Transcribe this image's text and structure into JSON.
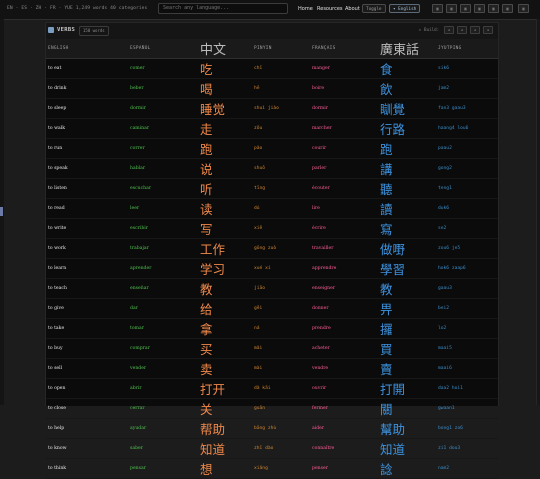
{
  "topbar": {
    "languages": "EN · ES · ZH · FR · YUE  1,249 words  40 categories",
    "search_placeholder": "Search any language...",
    "nav": [
      "Home",
      "Resources",
      "About"
    ],
    "toggle_label": "Toggle",
    "lang_pill": "▾ English"
  },
  "panel": {
    "title": "VERBS",
    "count": "150 words",
    "right_label": "▸ Build:"
  },
  "table": {
    "headers": [
      "ENGLISH",
      "ESPAÑOL",
      "中文",
      "PINYIN",
      "FRANÇAIS",
      "廣東話",
      "JYUTPING"
    ],
    "rows": [
      [
        "to eat",
        "comer",
        "吃",
        "chī",
        "manger",
        "食",
        "sik6"
      ],
      [
        "to drink",
        "beber",
        "喝",
        "hē",
        "boire",
        "飲",
        "jam2"
      ],
      [
        "to sleep",
        "dormir",
        "睡觉",
        "shuì jiào",
        "dormir",
        "瞓覺",
        "fan3 gaau3"
      ],
      [
        "to walk",
        "caminar",
        "走",
        "zǒu",
        "marcher",
        "行路",
        "haang4 lou6"
      ],
      [
        "to run",
        "correr",
        "跑",
        "pǎo",
        "courir",
        "跑",
        "paau2"
      ],
      [
        "to speak",
        "hablar",
        "说",
        "shuō",
        "parler",
        "講",
        "gong2"
      ],
      [
        "to listen",
        "escuchar",
        "听",
        "tīng",
        "écouter",
        "聽",
        "teng1"
      ],
      [
        "to read",
        "leer",
        "读",
        "dú",
        "lire",
        "讀",
        "duk6"
      ],
      [
        "to write",
        "escribir",
        "写",
        "xiě",
        "écrire",
        "寫",
        "se2"
      ],
      [
        "to work",
        "trabajar",
        "工作",
        "gōng zuò",
        "travailler",
        "做嘢",
        "zou6 je5"
      ],
      [
        "to learn",
        "aprender",
        "学习",
        "xué xí",
        "apprendre",
        "學習",
        "hok6 zaap6"
      ],
      [
        "to teach",
        "enseñar",
        "教",
        "jiāo",
        "enseigner",
        "教",
        "gaau3"
      ],
      [
        "to give",
        "dar",
        "给",
        "gěi",
        "donner",
        "畀",
        "bei2"
      ],
      [
        "to take",
        "tomar",
        "拿",
        "ná",
        "prendre",
        "攞",
        "lo2"
      ],
      [
        "to buy",
        "comprar",
        "买",
        "mǎi",
        "acheter",
        "買",
        "maai5"
      ],
      [
        "to sell",
        "vender",
        "卖",
        "mài",
        "vendre",
        "賣",
        "maai6"
      ],
      [
        "to open",
        "abrir",
        "打开",
        "dǎ kāi",
        "ouvrir",
        "打開",
        "daa2 hoi1"
      ],
      [
        "to close",
        "cerrar",
        "关",
        "guān",
        "fermer",
        "關",
        "gwaan1"
      ],
      [
        "to help",
        "ayudar",
        "帮助",
        "bāng zhù",
        "aider",
        "幫助",
        "bong1 zo6"
      ],
      [
        "to know",
        "saber",
        "知道",
        "zhī dào",
        "connaître",
        "知道",
        "zi1 dou3"
      ],
      [
        "to think",
        "pensar",
        "想",
        "xiǎng",
        "penser",
        "諗",
        "nam2"
      ]
    ]
  },
  "colors": {
    "english": "#e6e6e6",
    "spanish": "#4fc24f",
    "chinese": "#f0894a",
    "pinyin": "#d2862f",
    "french": "#ff5e9a",
    "cantonese": "#3d93e0",
    "jyutping": "#3a8cc9"
  }
}
